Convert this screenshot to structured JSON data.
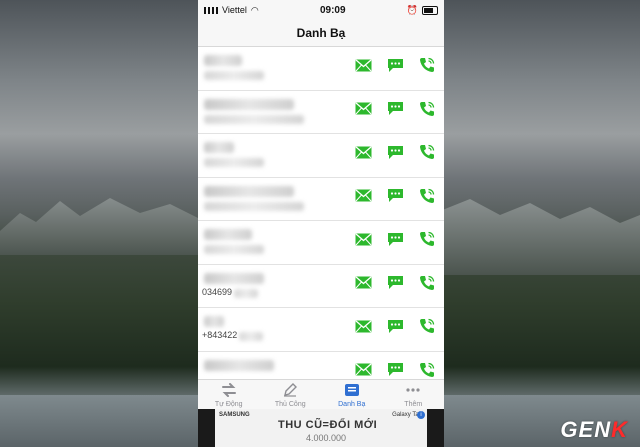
{
  "status_bar": {
    "carrier": "Viettel",
    "time": "09:09"
  },
  "nav": {
    "title": "Danh Bạ"
  },
  "contacts": [
    {
      "phone": ""
    },
    {
      "phone": ""
    },
    {
      "phone": ""
    },
    {
      "phone": ""
    },
    {
      "phone": ""
    },
    {
      "phone": "034699"
    },
    {
      "phone": "+843422"
    },
    {
      "phone": ""
    }
  ],
  "tabs": [
    {
      "label": "Tự Động",
      "icon": "swap-icon",
      "active": false
    },
    {
      "label": "Thủ Công",
      "icon": "pencil-icon",
      "active": false
    },
    {
      "label": "Danh Bạ",
      "icon": "contacts-book-icon",
      "active": true
    },
    {
      "label": "Thêm",
      "icon": "more-icon",
      "active": false
    }
  ],
  "ad": {
    "brand": "SAMSUNG",
    "product": "Galaxy Tab",
    "headline": "THU CŨ=ĐỔI MỚI",
    "price": "4.000.000"
  },
  "watermark": {
    "text": "GEN",
    "accent": "K"
  },
  "colors": {
    "action_green": "#2db82d",
    "tab_active": "#2f6fd1"
  }
}
